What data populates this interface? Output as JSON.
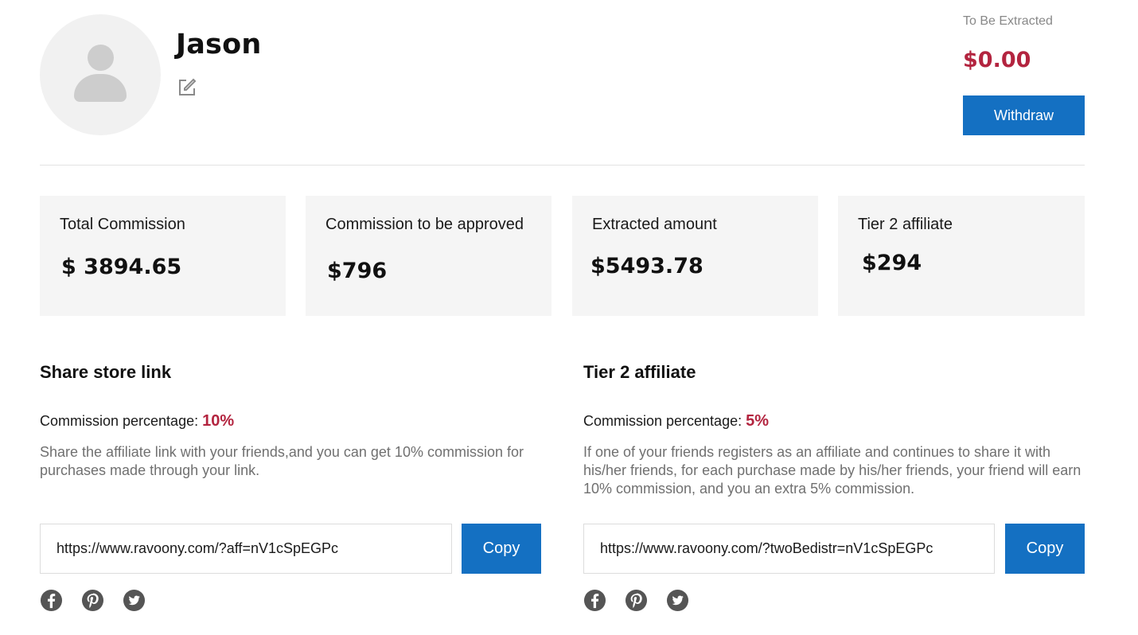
{
  "profile": {
    "name": "Jason"
  },
  "balance": {
    "label": "To Be Extracted",
    "amount": "$0.00",
    "withdraw_label": "Withdraw"
  },
  "stats": [
    {
      "label": "Total Commission",
      "value": "$ 3894.65"
    },
    {
      "label": "Commission to be approved",
      "value": "$796"
    },
    {
      "label": "Extracted amount",
      "value": "$5493.78"
    },
    {
      "label": "Tier 2 affiliate",
      "value": "$294"
    }
  ],
  "share_store": {
    "title": "Share store link",
    "rate_label": "Commission percentage:",
    "rate_value": "10%",
    "description": "Share the affiliate link with your friends,and you can get 10% commission for purchases made through your link.",
    "link": "https://www.ravoony.com/?aff=nV1cSpEGPc",
    "copy_label": "Copy"
  },
  "tier2": {
    "title": "Tier 2 affiliate",
    "rate_label": "Commission percentage:",
    "rate_value": "5%",
    "description": "If one of your friends registers as an affiliate and continues to share it with his/her friends, for each purchase made by his/her friends, your friend will earn 10% commission, and you an extra 5% commission.",
    "link": "https://www.ravoony.com/?twoBedistr=nV1cSpEGPc",
    "copy_label": "Copy"
  },
  "icons": {
    "avatar": "user-silhouette-icon",
    "edit": "edit-pencil-icon",
    "social": [
      "facebook-icon",
      "pinterest-icon",
      "twitter-icon"
    ]
  },
  "colors": {
    "accent": "#1470c2",
    "price": "#b3243f",
    "card_bg": "#f5f5f5",
    "social_icon": "#555555"
  }
}
